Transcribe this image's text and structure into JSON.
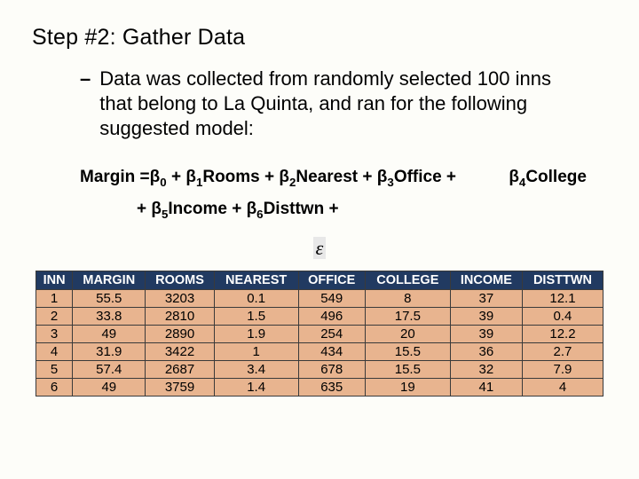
{
  "title": "Step #2: Gather Data",
  "bullet": "Data was collected from randomly selected 100 inns that belong to La Quinta, and ran for the following suggested model:",
  "formula": {
    "lhs": "Margin =",
    "p0a": "β",
    "p0s": "0",
    "p0b": " + ",
    "p1a": "β",
    "p1s": "1",
    "p1b": "Rooms + ",
    "p2a": "β",
    "p2s": "2",
    "p2b": "Nearest + ",
    "p3a": "β",
    "p3s": "3",
    "p3b": "Office + ",
    "p4a": "β",
    "p4s": "4",
    "p4b": "College",
    "line2_pre": "+ ",
    "p5a": "β",
    "p5s": "5",
    "p5b": "Income + ",
    "p6a": "β",
    "p6s": "6",
    "p6b": "Disttwn + "
  },
  "epsilon": "ε",
  "chart_data": {
    "type": "table",
    "columns": [
      "INN",
      "MARGIN",
      "ROOMS",
      "NEAREST",
      "OFFICE",
      "COLLEGE",
      "INCOME",
      "DISTTWN"
    ],
    "rows": [
      [
        "1",
        "55.5",
        "3203",
        "0.1",
        "549",
        "8",
        "37",
        "12.1"
      ],
      [
        "2",
        "33.8",
        "2810",
        "1.5",
        "496",
        "17.5",
        "39",
        "0.4"
      ],
      [
        "3",
        "49",
        "2890",
        "1.9",
        "254",
        "20",
        "39",
        "12.2"
      ],
      [
        "4",
        "31.9",
        "3422",
        "1",
        "434",
        "15.5",
        "36",
        "2.7"
      ],
      [
        "5",
        "57.4",
        "2687",
        "3.4",
        "678",
        "15.5",
        "32",
        "7.9"
      ],
      [
        "6",
        "49",
        "3759",
        "1.4",
        "635",
        "19",
        "41",
        "4"
      ]
    ]
  }
}
